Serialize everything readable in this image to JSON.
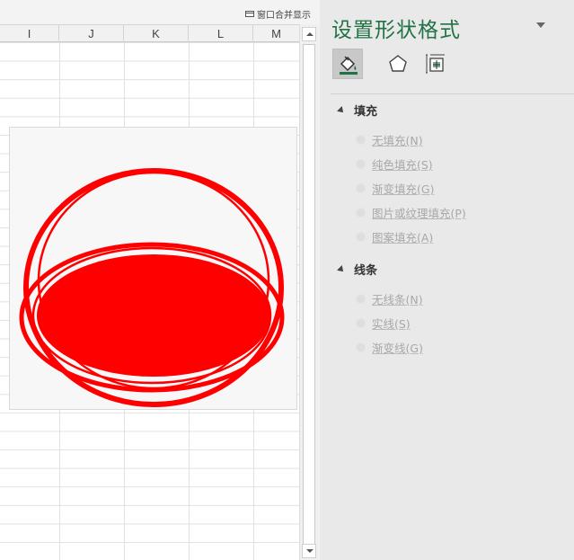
{
  "toolbar": {
    "merge_window_label": "窗口合并显示"
  },
  "sheet": {
    "columns": [
      "I",
      "J",
      "K",
      "L",
      "M"
    ]
  },
  "shape": {
    "fill_color": "#ff0000",
    "outline_color": "#ff0000"
  },
  "pane": {
    "title": "设置形状格式",
    "tabs": [
      "fill-line",
      "effects",
      "size-properties"
    ],
    "fill_section": {
      "label": "填充",
      "options": [
        "无填充(N)",
        "纯色填充(S)",
        "渐变填充(G)",
        "图片或纹理填充(P)",
        "图案填充(A)"
      ]
    },
    "line_section": {
      "label": "线条",
      "options": [
        "无线条(N)",
        "实线(S)",
        "渐变线(G)"
      ]
    }
  },
  "colors": {
    "accent": "#217346",
    "disabled_text": "#a8a8a8"
  }
}
